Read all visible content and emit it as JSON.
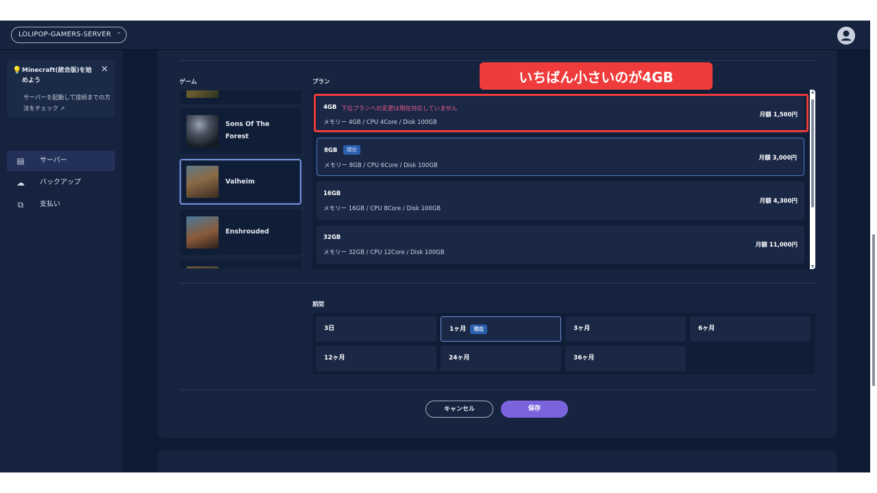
{
  "topbar": {
    "server_name": "LOLIPOP-GAMERS-SERVER",
    "server_chevron": "⌃⌄"
  },
  "sidebar": {
    "notice": {
      "title": "Minecraft(統合版)を始めよう",
      "body": "サーバーを起動して接続までの方法をチェック",
      "link_icon": "external-link-icon"
    },
    "items": [
      {
        "label": "サーバー",
        "icon": "server-icon",
        "active": true
      },
      {
        "label": "バックアップ",
        "icon": "cloud-upload-icon",
        "active": false
      },
      {
        "label": "支払い",
        "icon": "payment-icon",
        "active": false
      }
    ]
  },
  "labels": {
    "game": "ゲーム",
    "plan": "プラン",
    "period": "期間"
  },
  "games": [
    {
      "name": "",
      "partial": true
    },
    {
      "name": "Sons Of The Forest",
      "selected": false
    },
    {
      "name": "Valheim",
      "selected": true
    },
    {
      "name": "Enshrouded",
      "selected": false
    },
    {
      "name": "",
      "partial": true
    }
  ],
  "plans": [
    {
      "name": "4GB",
      "warning": "下位プランへの変更は現在対応していません",
      "spec": "メモリー 4GB / CPU 4Core / Disk 100GB",
      "price": "月額 1,500円",
      "current": false
    },
    {
      "name": "8GB",
      "badge": "現在",
      "spec": "メモリー 8GB / CPU 6Core / Disk 100GB",
      "price": "月額 3,000円",
      "current": true
    },
    {
      "name": "16GB",
      "spec": "メモリー 16GB / CPU 8Core / Disk 100GB",
      "price": "月額 4,300円",
      "current": false
    },
    {
      "name": "32GB",
      "spec": "メモリー 32GB / CPU 12Core / Disk 100GB",
      "price": "月額 11,000円",
      "current": false
    }
  ],
  "periods": [
    {
      "label": "3日"
    },
    {
      "label": "1ヶ月",
      "badge": "現在",
      "current": true
    },
    {
      "label": "3ヶ月"
    },
    {
      "label": "6ヶ月"
    },
    {
      "label": "12ヶ月"
    },
    {
      "label": "24ヶ月"
    },
    {
      "label": "36ヶ月"
    }
  ],
  "buttons": {
    "cancel": "キャンセル",
    "save": "保存"
  },
  "annotation": {
    "callout": "いちばん小さいのが4GB",
    "color": "#ef3b3b"
  },
  "colors": {
    "accent": "#7b63dd",
    "warning": "#ef5a8d",
    "badge": "#2a5fae"
  }
}
